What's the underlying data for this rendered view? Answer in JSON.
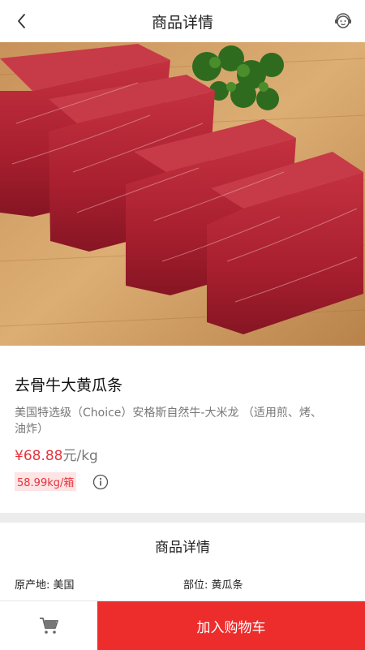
{
  "header": {
    "title": "商品详情"
  },
  "product": {
    "name": "去骨牛大黄瓜条",
    "description": "美国特选级（Choice）安格斯自然牛-大米龙 （适用煎、烤、油炸）",
    "price": "¥68.88",
    "unit": "元/kg",
    "box_price": "58.99kg/箱"
  },
  "details": {
    "title": "商品详情",
    "origin": "原产地: 美国",
    "part": "部位: 黄瓜条"
  },
  "bottom_bar": {
    "add_to_cart": "加入购物车"
  },
  "colors": {
    "accent": "#ed2c2c",
    "price": "#e8323b",
    "badge_bg": "#fde4e5"
  }
}
